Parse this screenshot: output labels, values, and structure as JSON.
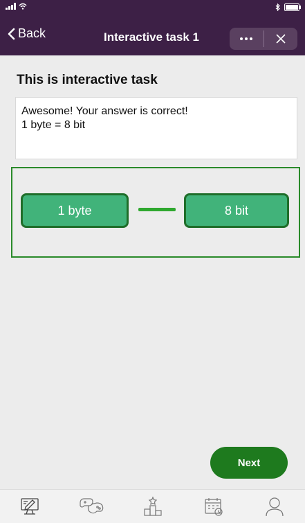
{
  "nav": {
    "back_label": "Back",
    "title": "Interactive task 1"
  },
  "task": {
    "heading": "This is interactive task",
    "feedback_line1": "Awesome! Your answer is correct!",
    "feedback_line2": "1 byte = 8 bit"
  },
  "match": {
    "left_tile": "1 byte",
    "right_tile": "8 bit"
  },
  "actions": {
    "next_label": "Next"
  },
  "tabs": [
    "lesson-icon",
    "games-icon",
    "leaderboard-icon",
    "calendar-icon",
    "profile-icon"
  ],
  "colors": {
    "nav_bg": "#3d2046",
    "tile_bg": "#41b37a",
    "tile_border": "#1f6e2a",
    "match_border": "#2a8a2a",
    "next_bg": "#1e7a1e"
  }
}
